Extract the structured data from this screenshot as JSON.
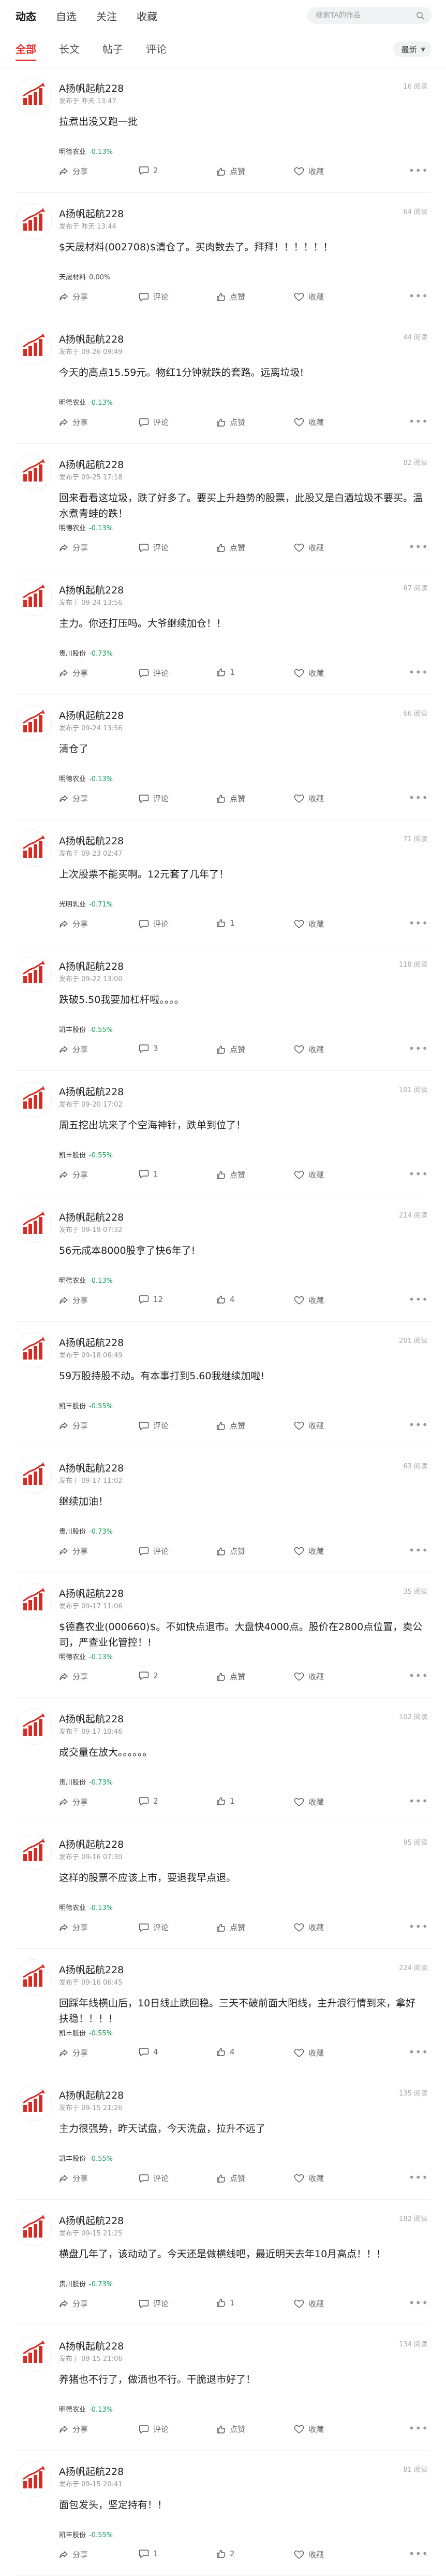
{
  "top_tabs": [
    "动态",
    "自选",
    "关注",
    "收藏"
  ],
  "search": {
    "placeholder": "搜索TA的作品"
  },
  "sub_tabs": [
    "全部",
    "长文",
    "帖子",
    "评论"
  ],
  "sort": {
    "selected": "最新"
  },
  "colors": {
    "accent": "#e8322e",
    "down": "#14a05a"
  },
  "icons": [
    "search-icon",
    "chevron-down-icon",
    "avatar-chart-icon",
    "share-icon",
    "comment-icon",
    "like-icon",
    "favorite-icon",
    "more-icon"
  ],
  "posts": [
    {
      "user": "A扬帆起航228",
      "time": "发布于 昨天 13:47",
      "views": "16 阅读",
      "text": "拉煮出没又跑一批",
      "stock": "明德农业",
      "change": "-0.13%",
      "dir": "down",
      "share": "分享",
      "comments": "2",
      "likes": "点赞",
      "fav": "收藏"
    },
    {
      "user": "A扬帆起航228",
      "time": "发布于 昨天 13:44",
      "views": "64 阅读",
      "text": "$天晟材料(002708)$清仓了。买肉数去了。拜拜！！！！！！",
      "stock": "天晟材料",
      "change": "0.00%",
      "dir": "flat",
      "share": "分享",
      "comments": "评论",
      "likes": "点赞",
      "fav": "收藏"
    },
    {
      "user": "A扬帆起航228",
      "time": "发布于 09-26 09:49",
      "views": "44 阅读",
      "text": "今天的高点15.59元。物红1分钟就跌的套路。远离垃圾!",
      "stock": "明德农业",
      "change": "-0.13%",
      "dir": "down",
      "share": "分享",
      "comments": "评论",
      "likes": "点赞",
      "fav": "收藏"
    },
    {
      "user": "A扬帆起航228",
      "time": "发布于 09-25 17:18",
      "views": "82 阅读",
      "text": "回来看看这垃圾，跌了好多了。要买上升趋势的股票，此股又是白酒垃圾不要买。温水煮青蛙的跌！",
      "stock": "明德农业",
      "change": "-0.13%",
      "dir": "down",
      "share": "分享",
      "comments": "评论",
      "likes": "点赞",
      "fav": "收藏"
    },
    {
      "user": "A扬帆起航228",
      "time": "发布于 09-24 13:56",
      "views": "67 阅读",
      "text": "主力。你还打压吗。大爷继续加仓！！",
      "stock": "贵川股份",
      "change": "-0.73%",
      "dir": "down",
      "share": "分享",
      "comments": "评论",
      "likes": "1",
      "fav": "收藏"
    },
    {
      "user": "A扬帆起航228",
      "time": "发布于 09-24 13:56",
      "views": "66 阅读",
      "text": "清仓了",
      "stock": "明德农业",
      "change": "-0.13%",
      "dir": "down",
      "share": "分享",
      "comments": "评论",
      "likes": "点赞",
      "fav": "收藏"
    },
    {
      "user": "A扬帆起航228",
      "time": "发布于 09-23 02:47",
      "views": "71 阅读",
      "text": "上次股票不能买啊。12元套了几年了！",
      "stock": "光明乳业",
      "change": "-0.71%",
      "dir": "down",
      "share": "分享",
      "comments": "评论",
      "likes": "1",
      "fav": "收藏"
    },
    {
      "user": "A扬帆起航228",
      "time": "发布于 09-22 13:00",
      "views": "118 阅读",
      "text": "跌破5.50我要加杠杆啦。。。。",
      "stock": "凯丰股份",
      "change": "-0.55%",
      "dir": "down",
      "share": "分享",
      "comments": "3",
      "likes": "点赞",
      "fav": "收藏"
    },
    {
      "user": "A扬帆起航228",
      "time": "发布于 09-20 17:02",
      "views": "101 阅读",
      "text": "周五挖出坑来了个空海神针，跌单到位了！",
      "stock": "凯丰股份",
      "change": "-0.55%",
      "dir": "down",
      "share": "分享",
      "comments": "1",
      "likes": "点赞",
      "fav": "收藏"
    },
    {
      "user": "A扬帆起航228",
      "time": "发布于 09-19 07:32",
      "views": "214 阅读",
      "text": "56元成本8000股拿了快6年了!",
      "stock": "明德农业",
      "change": "-0.13%",
      "dir": "down",
      "share": "分享",
      "comments": "12",
      "likes": "4",
      "fav": "收藏"
    },
    {
      "user": "A扬帆起航228",
      "time": "发布于 09-18 06:49",
      "views": "201 阅读",
      "text": "59万股持股不动。有本事打到5.60我继续加啦!",
      "stock": "凯丰股份",
      "change": "-0.55%",
      "dir": "down",
      "share": "分享",
      "comments": "评论",
      "likes": "点赞",
      "fav": "收藏"
    },
    {
      "user": "A扬帆起航228",
      "time": "发布于 09-17 11:02",
      "views": "63 阅读",
      "text": "继续加油！",
      "stock": "贵川股份",
      "change": "-0.73%",
      "dir": "down",
      "share": "分享",
      "comments": "评论",
      "likes": "点赞",
      "fav": "收藏"
    },
    {
      "user": "A扬帆起航228",
      "time": "发布于 09-17 11:06",
      "views": "35 阅读",
      "text": "$德鑫农业(000660)$。不如快点退市。大盘快4000点。股价在2800点位置，卖公司，严查业化管控！!",
      "stock": "明德农业",
      "change": "-0.13%",
      "dir": "down",
      "share": "分享",
      "comments": "2",
      "likes": "点赞",
      "fav": "收藏"
    },
    {
      "user": "A扬帆起航228",
      "time": "发布于 09-17 10:46",
      "views": "102 阅读",
      "text": "成交量在放大。。。。。。",
      "stock": "贵川股份",
      "change": "-0.73%",
      "dir": "down",
      "share": "分享",
      "comments": "2",
      "likes": "1",
      "fav": "收藏"
    },
    {
      "user": "A扬帆起航228",
      "time": "发布于 09-16 07:30",
      "views": "95 阅读",
      "text": "这样的股票不应该上市，要退我早点退。",
      "stock": "明德农业",
      "change": "-0.13%",
      "dir": "down",
      "share": "分享",
      "comments": "评论",
      "likes": "点赞",
      "fav": "收藏"
    },
    {
      "user": "A扬帆起航228",
      "time": "发布于 09-16 06:45",
      "views": "224 阅读",
      "text": "回踩年线横山后，10日线止跌回稳。三天不破前面大阳线，主升浪行情到来，拿好扶稳！！！！",
      "stock": "凯丰股份",
      "change": "-0.55%",
      "dir": "down",
      "share": "分享",
      "comments": "4",
      "likes": "4",
      "fav": "收藏"
    },
    {
      "user": "A扬帆起航228",
      "time": "发布于 09-15 21:26",
      "views": "135 阅读",
      "text": "主力很强势，昨天试盘，今天洗盘，拉升不远了",
      "stock": "凯丰股份",
      "change": "-0.55%",
      "dir": "down",
      "share": "分享",
      "comments": "评论",
      "likes": "点赞",
      "fav": "收藏"
    },
    {
      "user": "A扬帆起航228",
      "time": "发布于 09-15 21:25",
      "views": "182 阅读",
      "text": "横盘几年了，该动动了。今天还是做横线吧，最近明天去年10月高点！！！",
      "stock": "贵川股份",
      "change": "-0.73%",
      "dir": "down",
      "share": "分享",
      "comments": "评论",
      "likes": "1",
      "fav": "收藏"
    },
    {
      "user": "A扬帆起航228",
      "time": "发布于 09-15 21:06",
      "views": "134 阅读",
      "text": "养猪也不行了，做酒也不行。干脆退市好了！",
      "stock": "明德农业",
      "change": "-0.13%",
      "dir": "down",
      "share": "分享",
      "comments": "评论",
      "likes": "点赞",
      "fav": "收藏"
    },
    {
      "user": "A扬帆起航228",
      "time": "发布于 09-15 20:41",
      "views": "81 阅读",
      "text": "面包发头，坚定持有！！",
      "stock": "凯丰股份",
      "change": "-0.55%",
      "dir": "down",
      "share": "分享",
      "comments": "1",
      "likes": "2",
      "fav": "收藏"
    }
  ]
}
